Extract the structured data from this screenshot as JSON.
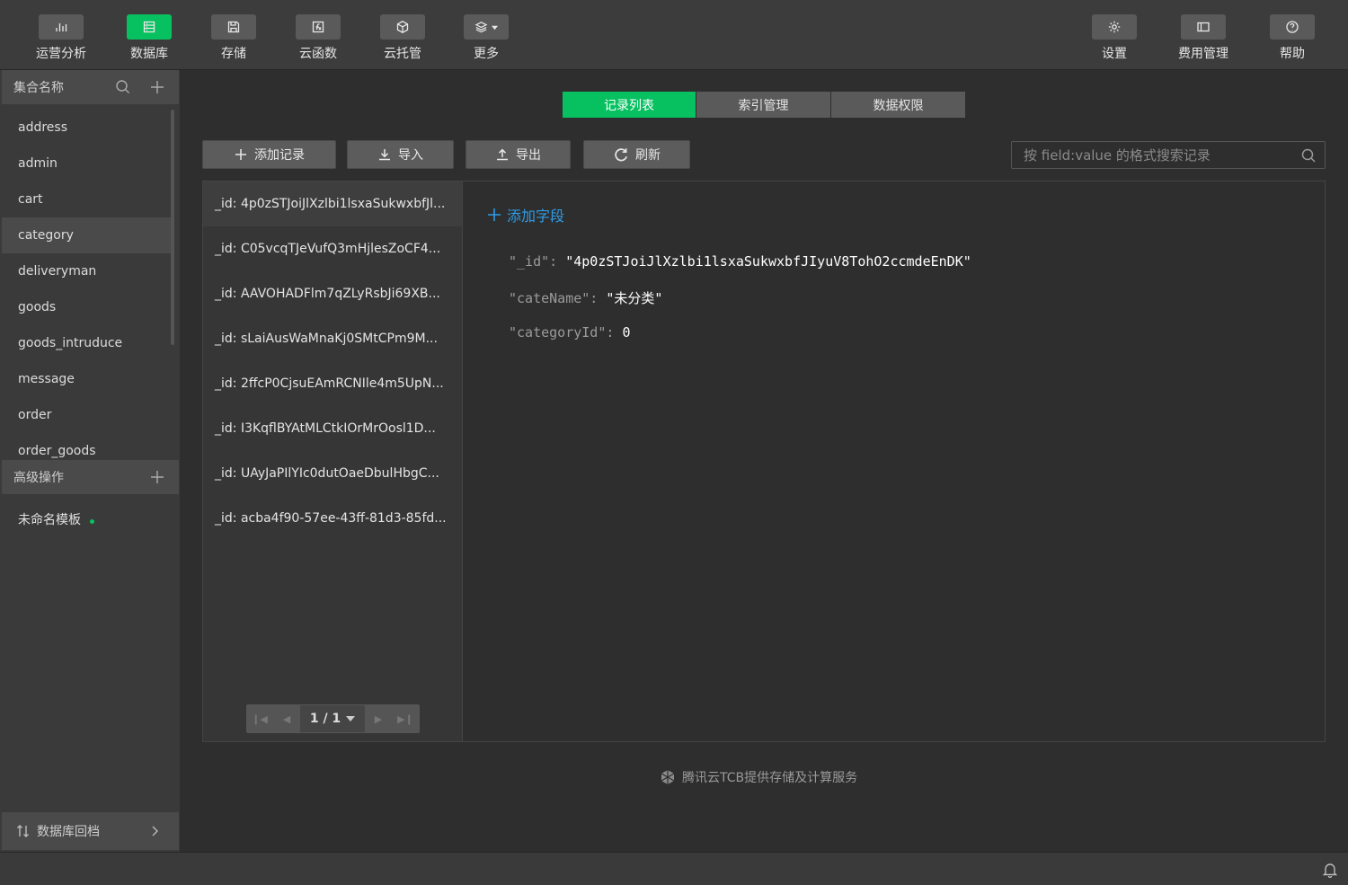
{
  "toolbar": {
    "left": [
      {
        "label": "运营分析",
        "icon": "bar-chart-icon"
      },
      {
        "label": "数据库",
        "icon": "database-icon"
      },
      {
        "label": "存储",
        "icon": "floppy-icon"
      },
      {
        "label": "云函数",
        "icon": "function-icon"
      },
      {
        "label": "云托管",
        "icon": "cube-icon"
      },
      {
        "label": "更多",
        "icon": "layers-icon"
      }
    ],
    "right": [
      {
        "label": "设置",
        "icon": "gear-icon"
      },
      {
        "label": "费用管理",
        "icon": "billing-icon"
      },
      {
        "label": "帮助",
        "icon": "help-icon"
      }
    ],
    "active_color": "#07c160"
  },
  "sidebar": {
    "collections_header": "集合名称",
    "collections": [
      "address",
      "admin",
      "cart",
      "category",
      "deliveryman",
      "goods",
      "goods_intruduce",
      "message",
      "order",
      "order_goods"
    ],
    "selected_collection": "category",
    "advanced_header": "高级操作",
    "template_name": "未命名模板",
    "footer": "数据库回档"
  },
  "tabs": [
    "记录列表",
    "索引管理",
    "数据权限"
  ],
  "actions": {
    "add_record": "添加记录",
    "import": "导入",
    "export": "导出",
    "refresh": "刷新"
  },
  "search": {
    "placeholder": "按 field:value 的格式搜索记录"
  },
  "records": [
    "_id: 4p0zSTJoiJlXzlbi1lsxaSukwxbfJl...",
    "_id: C05vcqTJeVufQ3mHjlesZoCF4...",
    "_id: AAVOHADFlm7qZLyRsbJi69XB...",
    "_id: sLaiAusWaMnaKj0SMtCPm9M...",
    "_id: 2ffcP0CjsuEAmRCNIle4m5UpN...",
    "_id: I3KqflBYAtMLCtkIOrMrOosl1D...",
    "_id: UAyJaPIlYIc0dutOaeDbulHbgC...",
    "_id: acba4f90-57ee-43ff-81d3-85fd..."
  ],
  "pager": {
    "label": "1 / 1"
  },
  "detail": {
    "add_field": "添加字段",
    "fields": [
      {
        "key": "\"_id\":",
        "value": "\"4p0zSTJoiJlXzlbi1lsxaSukwxbfJIyuV8TohO2ccmdeEnDK\""
      },
      {
        "key": "\"cateName\":",
        "value": "\"未分类\""
      },
      {
        "key": "\"categoryId\":",
        "value": "0"
      }
    ]
  },
  "footer_credit": "腾讯云TCB提供存储及计算服务"
}
